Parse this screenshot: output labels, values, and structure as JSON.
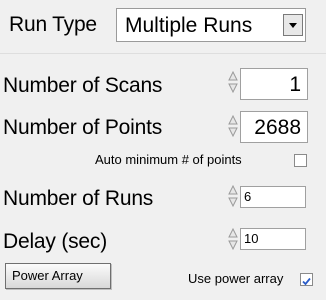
{
  "run_type": {
    "label": "Run Type",
    "value": "Multiple Runs"
  },
  "scans": {
    "label": "Number of Scans",
    "value": "1"
  },
  "points": {
    "label": "Number of Points",
    "value": "2688"
  },
  "auto_min": {
    "label": "Auto minimum # of points",
    "checked": false
  },
  "runs": {
    "label": "Number of Runs",
    "value": "6"
  },
  "delay": {
    "label": "Delay (sec)",
    "value": "10"
  },
  "power_array_button": {
    "label": "Power Array"
  },
  "use_power_array": {
    "label": "Use power array",
    "checked": true
  },
  "colors": {
    "background": "#f0f0f0",
    "checkmark": "#2a5cc8"
  }
}
